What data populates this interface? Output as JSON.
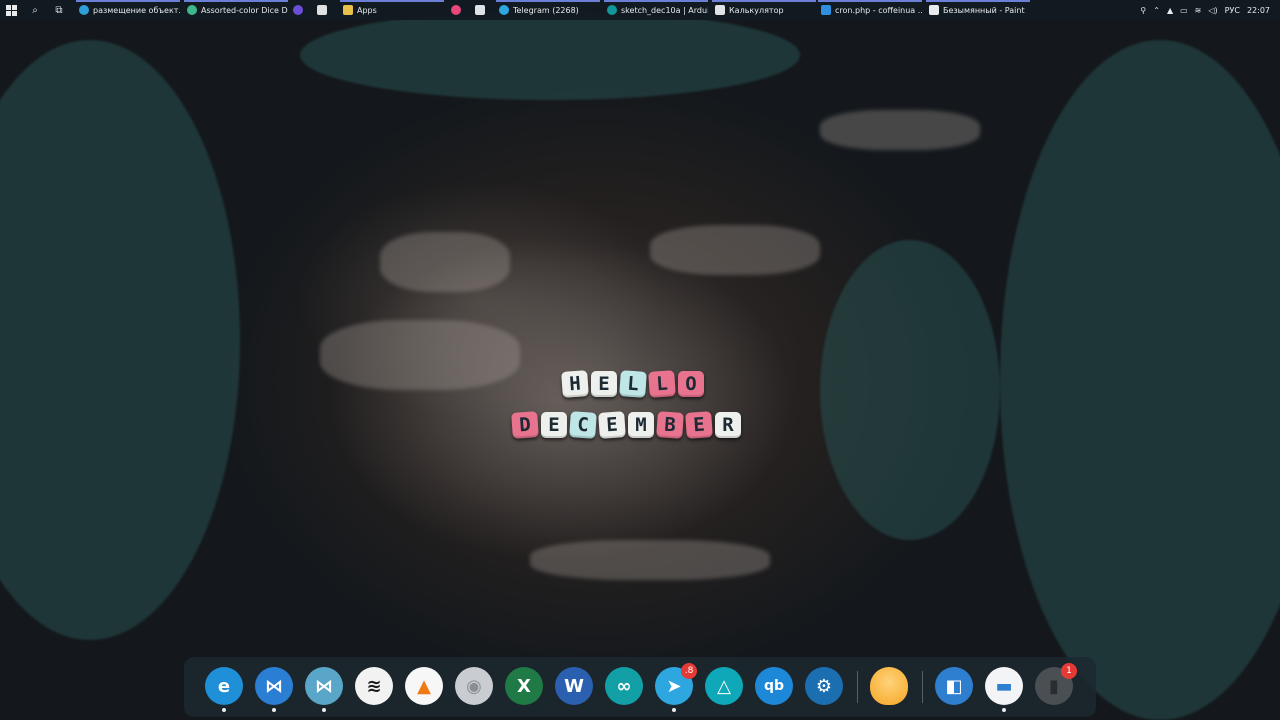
{
  "taskbar": {
    "items": [
      {
        "label": "размещение объект...",
        "icon": "edge-icon",
        "color": "#2f9fd8",
        "active": true
      },
      {
        "label": "Assorted-color Dice D...",
        "icon": "edge-icon",
        "color": "#3fb68b",
        "active": true
      },
      {
        "label": "",
        "icon": "app-icon",
        "color": "#6b4fd8",
        "active": false
      },
      {
        "label": "",
        "icon": "store-icon",
        "color": "#e0e0e0",
        "active": false
      },
      {
        "label": "Apps",
        "icon": "folder-icon",
        "color": "#e8c14a",
        "active": true
      },
      {
        "label": "",
        "icon": "app-icon",
        "color": "#e8477a",
        "active": false
      },
      {
        "label": "",
        "icon": "mail-icon",
        "color": "#dfe3e6",
        "active": false
      },
      {
        "label": "Telegram (2268)",
        "icon": "telegram-icon",
        "color": "#2ea6e0",
        "active": true
      },
      {
        "label": "sketch_dec10a | Ardui...",
        "icon": "arduino-icon",
        "color": "#11979b",
        "active": true
      },
      {
        "label": "Калькулятор",
        "icon": "calculator-icon",
        "color": "#dfe3e6",
        "active": true
      },
      {
        "label": "cron.php - coffeinua ...",
        "icon": "vscode-icon",
        "color": "#2f8fe0",
        "active": true
      },
      {
        "label": "Безымянный - Paint",
        "icon": "paint-icon",
        "color": "#e8eaec",
        "active": true
      }
    ],
    "tray": {
      "language": "РУС",
      "time": "22:07"
    }
  },
  "wallpaper": {
    "line1": "HELLO",
    "line2": "DECEMBER"
  },
  "dock": {
    "items": [
      {
        "name": "edge",
        "icon": "edge-icon",
        "color": "#1f8fd8",
        "glyph": "e",
        "running": true,
        "badge": ""
      },
      {
        "name": "vscode",
        "icon": "vscode-icon",
        "color": "#2a7fd4",
        "glyph": "⋈",
        "running": true,
        "badge": ""
      },
      {
        "name": "visual-studio",
        "icon": "visual-studio-icon",
        "color": "#5aa6c8",
        "glyph": "⋈",
        "running": true,
        "badge": ""
      },
      {
        "name": "spotify",
        "icon": "spotify-icon",
        "color": "#f2f2f2",
        "glyph": "≋",
        "running": false,
        "badge": ""
      },
      {
        "name": "vlc",
        "icon": "vlc-icon",
        "color": "#f7f7f7",
        "glyph": "▲",
        "running": false,
        "badge": ""
      },
      {
        "name": "disc",
        "icon": "disc-icon",
        "color": "#c9ccd0",
        "glyph": "◉",
        "running": false,
        "badge": ""
      },
      {
        "name": "excel",
        "icon": "excel-icon",
        "color": "#1f7a45",
        "glyph": "X",
        "running": false,
        "badge": ""
      },
      {
        "name": "word",
        "icon": "word-icon",
        "color": "#2b5fb0",
        "glyph": "W",
        "running": false,
        "badge": ""
      },
      {
        "name": "arduino",
        "icon": "arduino-icon",
        "color": "#12a0a6",
        "glyph": "∞",
        "running": false,
        "badge": ""
      },
      {
        "name": "telegram",
        "icon": "telegram-icon",
        "color": "#2ea6e0",
        "glyph": "➤",
        "running": true,
        "badge": ".8"
      },
      {
        "name": "affinity",
        "icon": "affinity-icon",
        "color": "#0fa8b8",
        "glyph": "△",
        "running": false,
        "badge": ""
      },
      {
        "name": "qbittorrent",
        "icon": "qbittorrent-icon",
        "color": "#1e88d8",
        "glyph": "qb",
        "running": false,
        "badge": ""
      },
      {
        "name": "steam",
        "icon": "steam-icon",
        "color": "#1b6fb0",
        "glyph": "⚙",
        "running": false,
        "badge": ""
      },
      {
        "name": "bulb",
        "icon": "lightbulb-icon",
        "color": "#f5b13a",
        "glyph": "",
        "running": false,
        "badge": ""
      },
      {
        "name": "remote",
        "icon": "remote-icon",
        "color": "#2f7fd0",
        "glyph": "◧",
        "running": false,
        "badge": ""
      },
      {
        "name": "files",
        "icon": "folder-icon",
        "color": "#f2f4f6",
        "glyph": "▬",
        "running": true,
        "badge": ""
      },
      {
        "name": "trash",
        "icon": "trash-icon",
        "color": "#4a4f54",
        "glyph": "▮",
        "running": false,
        "badge": "1"
      }
    ]
  }
}
